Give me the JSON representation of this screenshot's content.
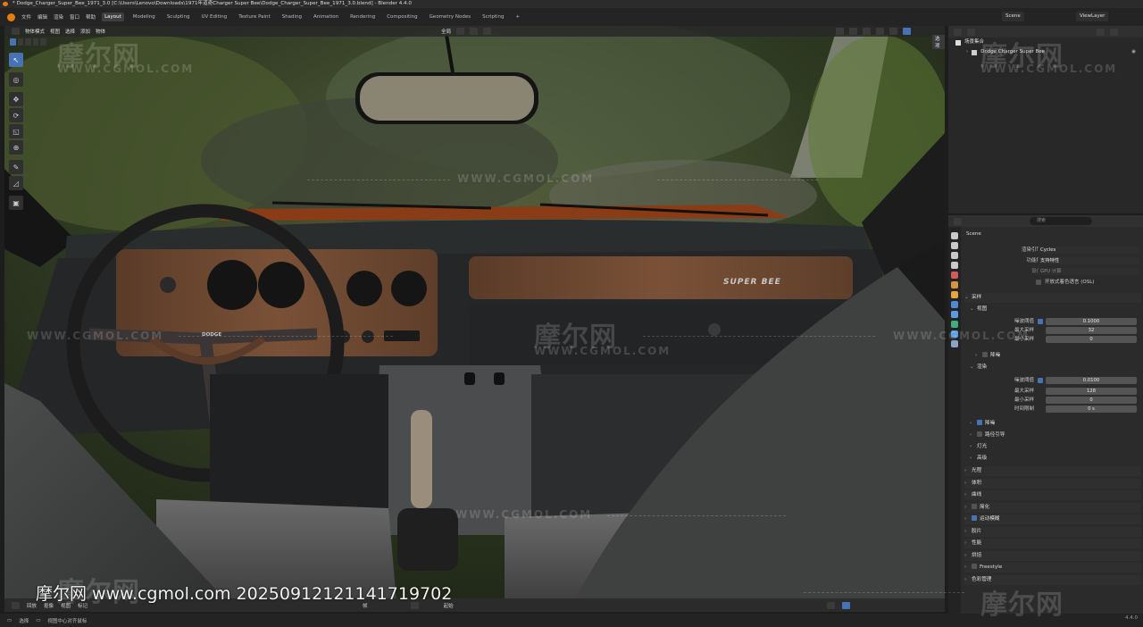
{
  "window": {
    "title": "* Dodge_Charger_Super_Bee_1971_3.0 [C:\\Users\\Lenovo\\Downloads\\1971年道奇Charger Super Bee\\Dodge_Charger_Super_Bee_1971_3.0.blend] - Blender 4.4.0"
  },
  "menu": {
    "items": [
      "文件",
      "编辑",
      "渲染",
      "窗口",
      "帮助"
    ],
    "workspaces": [
      "Layout",
      "Modeling",
      "Sculpting",
      "UV Editing",
      "Texture Paint",
      "Shading",
      "Animation",
      "Rendering",
      "Compositing",
      "Geometry Nodes",
      "Scripting"
    ],
    "active_workspace": "Layout",
    "add_workspace": "+",
    "scene": "Scene",
    "view_layer": "ViewLayer"
  },
  "viewport_header": {
    "mode": "物体模式",
    "menus": [
      "视图",
      "选择",
      "添加",
      "物体"
    ],
    "orientation": "全局",
    "options": "选项"
  },
  "outliner": {
    "root": "场景集合",
    "child": "Dodge Charger Super Bee"
  },
  "properties": {
    "search_placeholder": "搜索",
    "scene": "Scene",
    "render_engine_label": "渲染引擎",
    "render_engine": "Cycles",
    "feature_set_label": "功能集",
    "feature_set": "支持特性",
    "device_label": "设备",
    "device": "GPU 计算",
    "osl_label": "开放式着色语言 (OSL)",
    "sampling": "采样",
    "viewport": "视图",
    "noise_threshold_label": "噪波阈值",
    "vp_noise_threshold": "0.1000",
    "max_samples_label": "最大采样",
    "vp_max_samples": "32",
    "min_samples_label": "最小采样",
    "vp_min_samples": "0",
    "denoise": "降噪",
    "render": "渲染",
    "r_noise_threshold": "0.0100",
    "r_max_samples": "128",
    "r_min_samples": "0",
    "time_limit_label": "时间限制",
    "r_time_limit": "0 s",
    "denoise2": "降噪",
    "path_guiding": "路径引导",
    "lights": "灯光",
    "advanced": "高级",
    "sections": [
      "光程",
      "体积",
      "曲线",
      "简化",
      "运动模糊",
      "胶片",
      "性能",
      "烘焙",
      "Freestyle",
      "色彩管理"
    ]
  },
  "timeline": {
    "items": [
      "回放",
      "抠像",
      "视图",
      "标记"
    ],
    "frame_label": "帧",
    "start_label": "起始"
  },
  "status": {
    "select": "选择",
    "center": "视图中心对齐鼠标",
    "version": "4.4.0"
  },
  "watermark": {
    "logo": "摩尔网",
    "url": "WWW.CGMOL.COM",
    "caption": "摩尔网 www.cgmol.com 20250912121141719702"
  },
  "dash_label": {
    "brand": "SUPER BEE",
    "steering": "DODGE"
  }
}
